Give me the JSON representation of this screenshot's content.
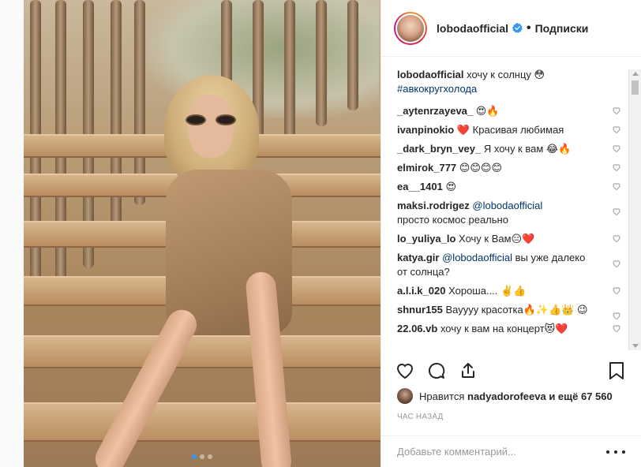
{
  "header": {
    "username": "lobodaofficial",
    "separator": "•",
    "follow_label": "Подписки"
  },
  "caption": {
    "username": "lobodaofficial",
    "text": "хочу к солнцу 😳",
    "hashtag": "#авкокругхолода"
  },
  "comments": [
    {
      "user": "_aytenrzayeva_",
      "text": "😍🔥"
    },
    {
      "user": "ivanpinokio",
      "text": "❤️ Красивая любимая"
    },
    {
      "user": "_dark_bryn_vey_",
      "text": "Я хочу к вам 😂🔥"
    },
    {
      "user": "elmirok_777",
      "text": "😊😊😊😊"
    },
    {
      "user": "ea__1401",
      "text": "😍"
    },
    {
      "user": "maksi.rodrigez",
      "mention": "@lobodaofficial",
      "text": "просто космос реально"
    },
    {
      "user": "lo_yuliya_lo",
      "text": "Хочу к Вам😑❤️"
    },
    {
      "user": "katya.gir",
      "mention": "@lobodaofficial",
      "text": "вы уже далеко от солнца?"
    },
    {
      "user": "a.l.i.k_020",
      "text": "Хороша.... ✌️👍"
    },
    {
      "user": "shnur155",
      "text": "Вауууу красотка🔥✨👍👑 😉"
    },
    {
      "user": "22.06.vb",
      "text": "хочу к вам на концерт😻❤️"
    }
  ],
  "likes": {
    "prefix": "Нравится",
    "user": "nadyadorofeeva",
    "suffix": "и ещё 67 560"
  },
  "timestamp": "ЧАС НАЗАД",
  "comment_input": {
    "placeholder": "Добавьте комментарий..."
  },
  "carousel": {
    "count": 3,
    "active": 0
  },
  "colors": {
    "link": "#003569",
    "verified": "#3897f0",
    "text": "#262626",
    "muted": "#999999"
  }
}
